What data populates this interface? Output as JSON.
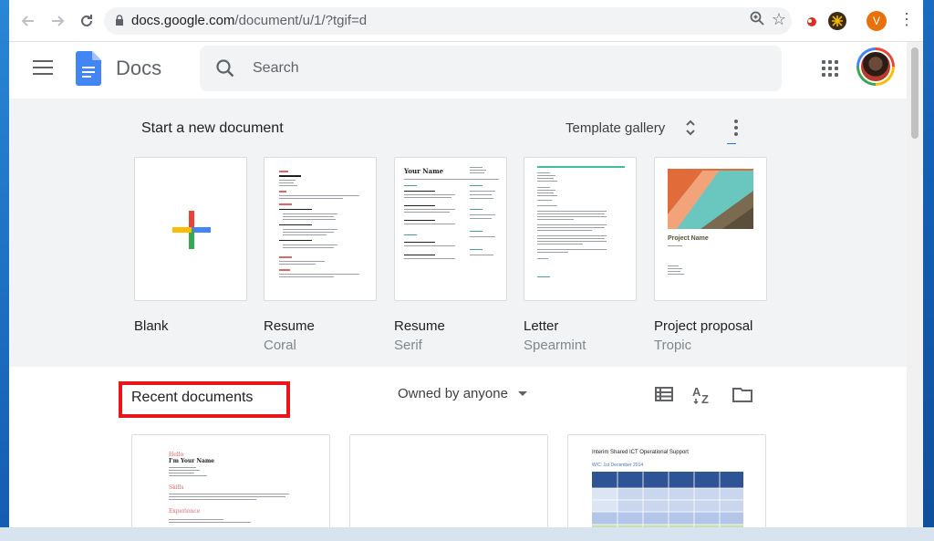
{
  "browser": {
    "url_host": "docs.google.com",
    "url_path": "/document/u/1/?tgif=d",
    "profile_initial": "V",
    "icons": [
      "back-icon",
      "forward-icon",
      "reload-icon",
      "lock-icon",
      "zoom-icon",
      "star-icon",
      "menu-icon"
    ]
  },
  "app": {
    "title": "Docs",
    "search_placeholder": "Search"
  },
  "templates": {
    "heading": "Start a new document",
    "gallery_label": "Template gallery",
    "items": [
      {
        "name": "Blank",
        "subtitle": ""
      },
      {
        "name": "Resume",
        "subtitle": "Coral"
      },
      {
        "name": "Resume",
        "subtitle": "Serif"
      },
      {
        "name": "Letter",
        "subtitle": "Spearmint"
      },
      {
        "name": "Project proposal",
        "subtitle": "Tropic"
      }
    ],
    "serif_thumb_title": "Your Name",
    "tropic_thumb_title": "Project Name"
  },
  "recent": {
    "heading": "Recent documents",
    "owner_filter": "Owned by anyone",
    "doc1_hello": "Hello",
    "doc1_name": "I'm Your Name",
    "doc1_skills": "Skills",
    "doc1_experience": "Experience",
    "doc3_title": "Interim Shared ICT Operational Support",
    "doc3_sub": "W/C: 1st December 2014"
  },
  "colors": {
    "highlight_box": "#e8151b",
    "docs_blue": "#4285f4",
    "accent_coral": "#e06666",
    "accent_teal": "#45a0a0"
  }
}
